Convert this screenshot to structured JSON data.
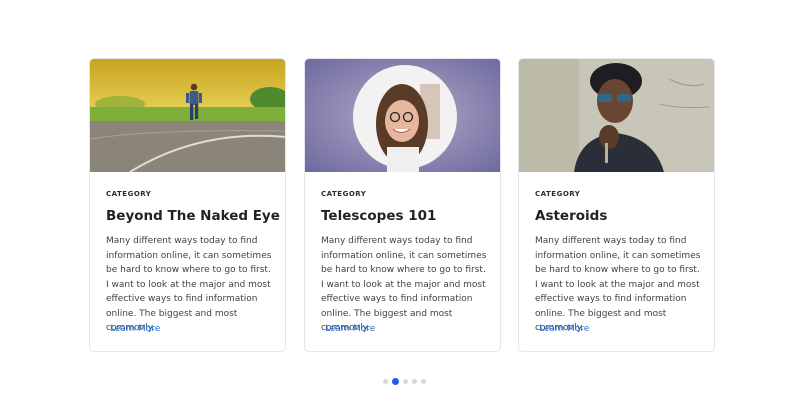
{
  "cards": [
    {
      "category": "CATEGORY",
      "title": "Beyond The Naked Eye",
      "description": "Many different ways today to find information online, it can sometimes be hard to know where to go to first. I want to look at the major and most effective ways to find information online.   The biggest and most commonly.",
      "link": "Learn More",
      "image": "runner-on-road-photo"
    },
    {
      "category": "CATEGORY",
      "title": "Telescopes 101",
      "description": "Many different ways today to find information online, it can sometimes be hard to know where to go to first. I want to look at the major and most effective ways to find information online.   The biggest and most commonly.",
      "link": "Learn More",
      "image": "smiling-woman-photo"
    },
    {
      "category": "CATEGORY",
      "title": "Asteroids",
      "description": "Many different ways today to find information online, it can sometimes be hard to know where to go to first. I want to look at the major and most effective ways to find information online.   The biggest and most commonly.",
      "link": "Learn More",
      "image": "man-with-sunglasses-photo"
    }
  ],
  "pagination": {
    "total": 5,
    "active_index": 1
  },
  "colors": {
    "link": "#2a6fd6",
    "active_dot": "#1f5fe0",
    "inactive_dot": "#d6d8dd"
  }
}
